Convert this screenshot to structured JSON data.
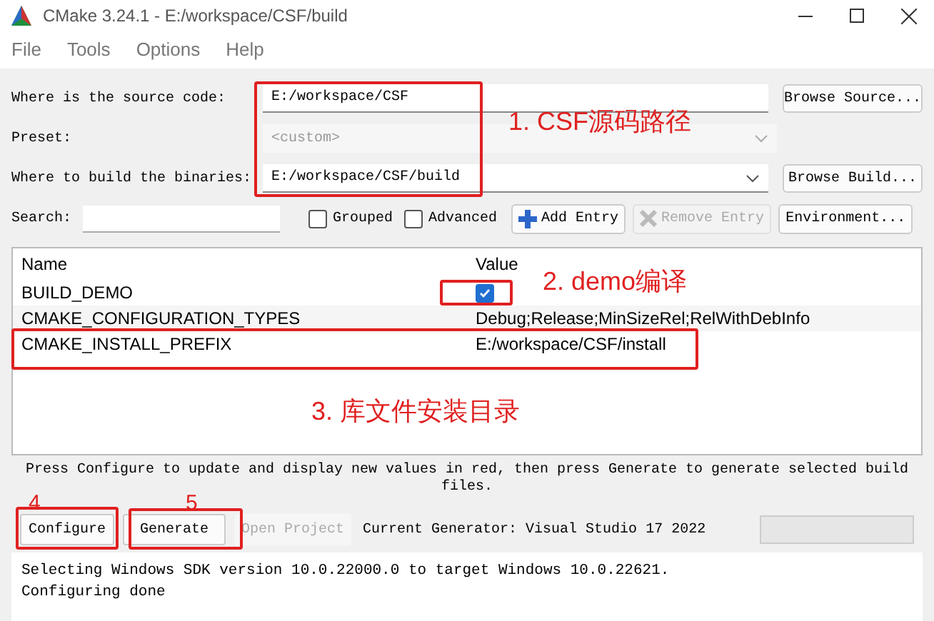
{
  "window": {
    "title": "CMake 3.24.1 - E:/workspace/CSF/build"
  },
  "menu": [
    "File",
    "Tools",
    "Options",
    "Help"
  ],
  "source": {
    "label": "Where is the source code:",
    "value": "E:/workspace/CSF",
    "button": "Browse Source..."
  },
  "preset": {
    "label": "Preset:",
    "value": "<custom>",
    "disabled": true
  },
  "build": {
    "label": "Where to build the binaries:",
    "value": "E:/workspace/CSF/build",
    "button": "Browse Build..."
  },
  "search": {
    "label": "Search:"
  },
  "options": [
    {
      "label": "Grouped",
      "checked": false
    },
    {
      "label": "Advanced",
      "checked": false
    }
  ],
  "entry_buttons": [
    {
      "label": "Add Entry",
      "kind": "add",
      "disabled": false
    },
    {
      "label": "Remove Entry",
      "kind": "remove",
      "disabled": true
    },
    {
      "label": "Environment...",
      "kind": "plain",
      "disabled": false
    }
  ],
  "table": {
    "columns": [
      "Name",
      "Value"
    ],
    "rows": [
      {
        "name": "BUILD_DEMO",
        "kind": "checkbox",
        "checked": true
      },
      {
        "name": "CMAKE_CONFIGURATION_TYPES",
        "kind": "text",
        "value": "Debug;Release;MinSizeRel;RelWithDebInfo"
      },
      {
        "name": "CMAKE_INSTALL_PREFIX",
        "kind": "text",
        "value": "E:/workspace/CSF/install"
      }
    ]
  },
  "hint": "Press Configure to update and display new values in red, then press Generate to generate selected build files.",
  "actions": [
    {
      "label": "Configure",
      "disabled": false
    },
    {
      "label": "Generate",
      "disabled": false
    },
    {
      "label": "Open Project",
      "disabled": true
    }
  ],
  "generator": "Current Generator: Visual Studio 17 2022",
  "progress": {
    "level": 0
  },
  "log": [
    "Selecting Windows SDK version 10.0.22000.0 to target Windows 10.0.22621.",
    "Configuring done"
  ],
  "annotations": [
    "1. CSF源码路径",
    "2. demo编译",
    "3. 库文件安装目录",
    "4",
    "5"
  ]
}
